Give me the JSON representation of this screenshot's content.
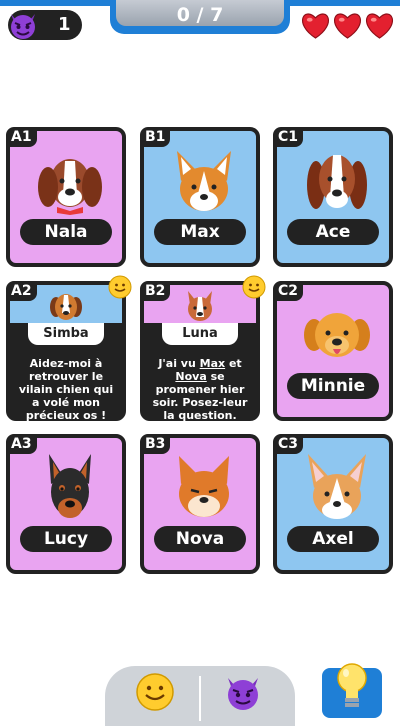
{
  "header": {
    "devil_count": "1",
    "progress_text": "0 / 7",
    "lives": 3
  },
  "colors": {
    "pink_card": "#e9a4f1",
    "blue_card": "#8ec6f0",
    "accent_blue": "#1f7fd6",
    "heart_red": "#e3202f"
  },
  "cards": {
    "a1": {
      "tag": "A1",
      "name": "Nala",
      "icon": "basset-dog-icon"
    },
    "b1": {
      "tag": "B1",
      "name": "Max",
      "icon": "corgi-dog-icon"
    },
    "c1": {
      "tag": "C1",
      "name": "Ace",
      "icon": "bloodhound-dog-icon"
    },
    "a2": {
      "tag": "A2",
      "name": "Simba",
      "clue": "Aidez-moi à retrouver le vilain chien qui a volé mon précieux os !"
    },
    "b2": {
      "tag": "B2",
      "name": "Luna",
      "clue_pre": "J'ai vu ",
      "clue_name1": "Max",
      "clue_mid": " et ",
      "clue_name2": "Nova",
      "clue_post": " se promener hier soir. Posez-leur la question."
    },
    "c2": {
      "tag": "C2",
      "name": "Minnie",
      "icon": "golden-dog-icon"
    },
    "a3": {
      "tag": "A3",
      "name": "Lucy",
      "icon": "doberman-dog-icon"
    },
    "b3": {
      "tag": "B3",
      "name": "Nova",
      "icon": "shiba-dog-icon"
    },
    "c3": {
      "tag": "C3",
      "name": "Axel",
      "icon": "corgi-white-dog-icon"
    }
  },
  "bottom": {
    "left_button_icon": "smiley-icon",
    "right_button_icon": "devil-icon",
    "hint_icon": "lightbulb-icon"
  }
}
